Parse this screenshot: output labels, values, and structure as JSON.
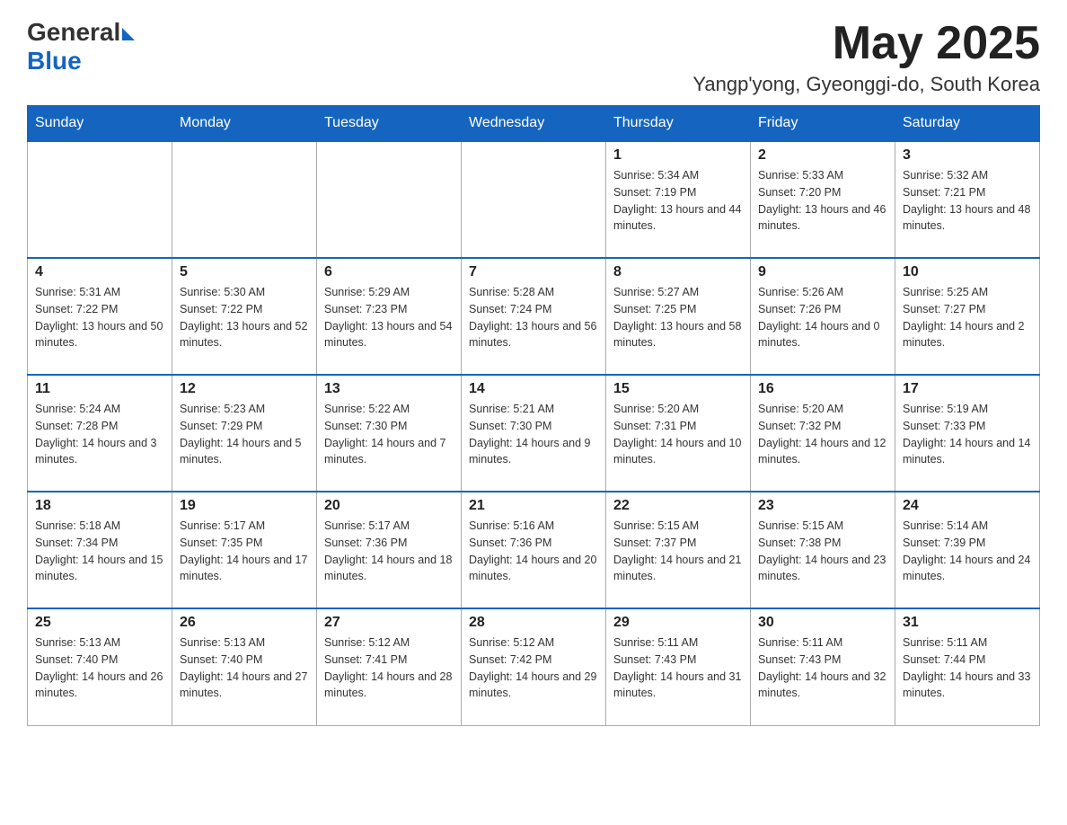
{
  "header": {
    "logo_general": "General",
    "logo_blue": "Blue",
    "month_year": "May 2025",
    "location": "Yangp'yong, Gyeonggi-do, South Korea"
  },
  "days_of_week": [
    "Sunday",
    "Monday",
    "Tuesday",
    "Wednesday",
    "Thursday",
    "Friday",
    "Saturday"
  ],
  "weeks": [
    [
      {
        "day": "",
        "sunrise": "",
        "sunset": "",
        "daylight": ""
      },
      {
        "day": "",
        "sunrise": "",
        "sunset": "",
        "daylight": ""
      },
      {
        "day": "",
        "sunrise": "",
        "sunset": "",
        "daylight": ""
      },
      {
        "day": "",
        "sunrise": "",
        "sunset": "",
        "daylight": ""
      },
      {
        "day": "1",
        "sunrise": "Sunrise: 5:34 AM",
        "sunset": "Sunset: 7:19 PM",
        "daylight": "Daylight: 13 hours and 44 minutes."
      },
      {
        "day": "2",
        "sunrise": "Sunrise: 5:33 AM",
        "sunset": "Sunset: 7:20 PM",
        "daylight": "Daylight: 13 hours and 46 minutes."
      },
      {
        "day": "3",
        "sunrise": "Sunrise: 5:32 AM",
        "sunset": "Sunset: 7:21 PM",
        "daylight": "Daylight: 13 hours and 48 minutes."
      }
    ],
    [
      {
        "day": "4",
        "sunrise": "Sunrise: 5:31 AM",
        "sunset": "Sunset: 7:22 PM",
        "daylight": "Daylight: 13 hours and 50 minutes."
      },
      {
        "day": "5",
        "sunrise": "Sunrise: 5:30 AM",
        "sunset": "Sunset: 7:22 PM",
        "daylight": "Daylight: 13 hours and 52 minutes."
      },
      {
        "day": "6",
        "sunrise": "Sunrise: 5:29 AM",
        "sunset": "Sunset: 7:23 PM",
        "daylight": "Daylight: 13 hours and 54 minutes."
      },
      {
        "day": "7",
        "sunrise": "Sunrise: 5:28 AM",
        "sunset": "Sunset: 7:24 PM",
        "daylight": "Daylight: 13 hours and 56 minutes."
      },
      {
        "day": "8",
        "sunrise": "Sunrise: 5:27 AM",
        "sunset": "Sunset: 7:25 PM",
        "daylight": "Daylight: 13 hours and 58 minutes."
      },
      {
        "day": "9",
        "sunrise": "Sunrise: 5:26 AM",
        "sunset": "Sunset: 7:26 PM",
        "daylight": "Daylight: 14 hours and 0 minutes."
      },
      {
        "day": "10",
        "sunrise": "Sunrise: 5:25 AM",
        "sunset": "Sunset: 7:27 PM",
        "daylight": "Daylight: 14 hours and 2 minutes."
      }
    ],
    [
      {
        "day": "11",
        "sunrise": "Sunrise: 5:24 AM",
        "sunset": "Sunset: 7:28 PM",
        "daylight": "Daylight: 14 hours and 3 minutes."
      },
      {
        "day": "12",
        "sunrise": "Sunrise: 5:23 AM",
        "sunset": "Sunset: 7:29 PM",
        "daylight": "Daylight: 14 hours and 5 minutes."
      },
      {
        "day": "13",
        "sunrise": "Sunrise: 5:22 AM",
        "sunset": "Sunset: 7:30 PM",
        "daylight": "Daylight: 14 hours and 7 minutes."
      },
      {
        "day": "14",
        "sunrise": "Sunrise: 5:21 AM",
        "sunset": "Sunset: 7:30 PM",
        "daylight": "Daylight: 14 hours and 9 minutes."
      },
      {
        "day": "15",
        "sunrise": "Sunrise: 5:20 AM",
        "sunset": "Sunset: 7:31 PM",
        "daylight": "Daylight: 14 hours and 10 minutes."
      },
      {
        "day": "16",
        "sunrise": "Sunrise: 5:20 AM",
        "sunset": "Sunset: 7:32 PM",
        "daylight": "Daylight: 14 hours and 12 minutes."
      },
      {
        "day": "17",
        "sunrise": "Sunrise: 5:19 AM",
        "sunset": "Sunset: 7:33 PM",
        "daylight": "Daylight: 14 hours and 14 minutes."
      }
    ],
    [
      {
        "day": "18",
        "sunrise": "Sunrise: 5:18 AM",
        "sunset": "Sunset: 7:34 PM",
        "daylight": "Daylight: 14 hours and 15 minutes."
      },
      {
        "day": "19",
        "sunrise": "Sunrise: 5:17 AM",
        "sunset": "Sunset: 7:35 PM",
        "daylight": "Daylight: 14 hours and 17 minutes."
      },
      {
        "day": "20",
        "sunrise": "Sunrise: 5:17 AM",
        "sunset": "Sunset: 7:36 PM",
        "daylight": "Daylight: 14 hours and 18 minutes."
      },
      {
        "day": "21",
        "sunrise": "Sunrise: 5:16 AM",
        "sunset": "Sunset: 7:36 PM",
        "daylight": "Daylight: 14 hours and 20 minutes."
      },
      {
        "day": "22",
        "sunrise": "Sunrise: 5:15 AM",
        "sunset": "Sunset: 7:37 PM",
        "daylight": "Daylight: 14 hours and 21 minutes."
      },
      {
        "day": "23",
        "sunrise": "Sunrise: 5:15 AM",
        "sunset": "Sunset: 7:38 PM",
        "daylight": "Daylight: 14 hours and 23 minutes."
      },
      {
        "day": "24",
        "sunrise": "Sunrise: 5:14 AM",
        "sunset": "Sunset: 7:39 PM",
        "daylight": "Daylight: 14 hours and 24 minutes."
      }
    ],
    [
      {
        "day": "25",
        "sunrise": "Sunrise: 5:13 AM",
        "sunset": "Sunset: 7:40 PM",
        "daylight": "Daylight: 14 hours and 26 minutes."
      },
      {
        "day": "26",
        "sunrise": "Sunrise: 5:13 AM",
        "sunset": "Sunset: 7:40 PM",
        "daylight": "Daylight: 14 hours and 27 minutes."
      },
      {
        "day": "27",
        "sunrise": "Sunrise: 5:12 AM",
        "sunset": "Sunset: 7:41 PM",
        "daylight": "Daylight: 14 hours and 28 minutes."
      },
      {
        "day": "28",
        "sunrise": "Sunrise: 5:12 AM",
        "sunset": "Sunset: 7:42 PM",
        "daylight": "Daylight: 14 hours and 29 minutes."
      },
      {
        "day": "29",
        "sunrise": "Sunrise: 5:11 AM",
        "sunset": "Sunset: 7:43 PM",
        "daylight": "Daylight: 14 hours and 31 minutes."
      },
      {
        "day": "30",
        "sunrise": "Sunrise: 5:11 AM",
        "sunset": "Sunset: 7:43 PM",
        "daylight": "Daylight: 14 hours and 32 minutes."
      },
      {
        "day": "31",
        "sunrise": "Sunrise: 5:11 AM",
        "sunset": "Sunset: 7:44 PM",
        "daylight": "Daylight: 14 hours and 33 minutes."
      }
    ]
  ]
}
